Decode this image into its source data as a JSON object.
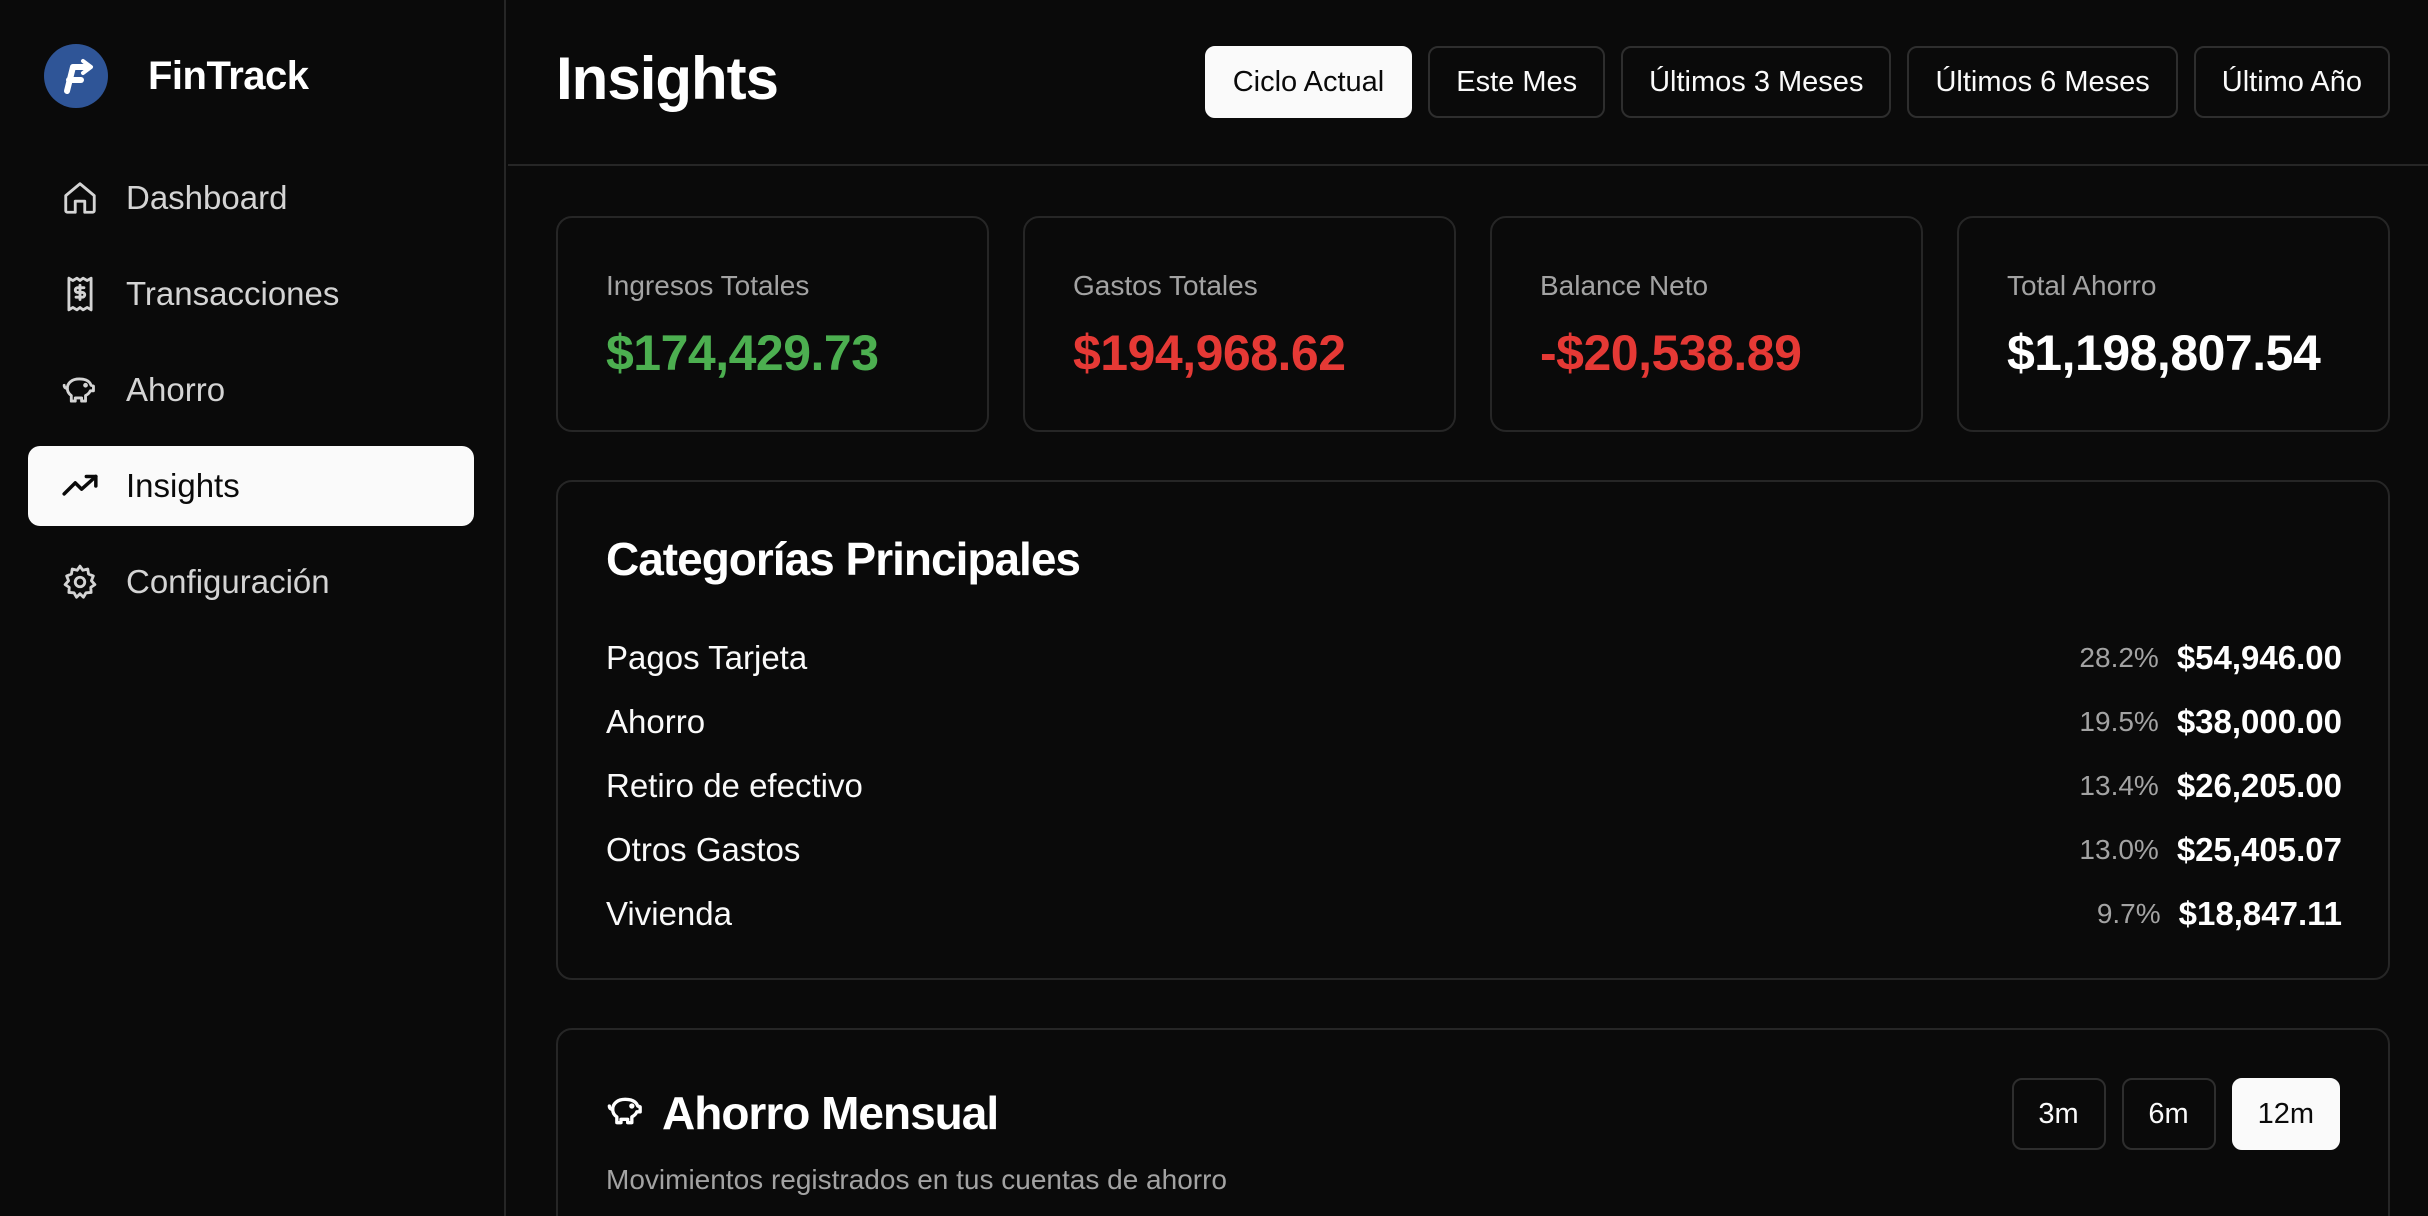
{
  "app": {
    "name": "FinTrack"
  },
  "sidebar": {
    "items": [
      {
        "label": "Dashboard",
        "icon": "home-icon",
        "active": false
      },
      {
        "label": "Transacciones",
        "icon": "receipt-icon",
        "active": false
      },
      {
        "label": "Ahorro",
        "icon": "piggy-bank-icon",
        "active": false
      },
      {
        "label": "Insights",
        "icon": "trending-up-icon",
        "active": true
      },
      {
        "label": "Configuración",
        "icon": "gear-icon",
        "active": false
      }
    ]
  },
  "header": {
    "title": "Insights",
    "ranges": [
      {
        "label": "Ciclo Actual",
        "active": true
      },
      {
        "label": "Este Mes",
        "active": false
      },
      {
        "label": "Últimos 3 Meses",
        "active": false
      },
      {
        "label": "Últimos 6 Meses",
        "active": false
      },
      {
        "label": "Último Año",
        "active": false
      }
    ]
  },
  "stats": [
    {
      "label": "Ingresos Totales",
      "value": "$174,429.73",
      "color": "#4caf50"
    },
    {
      "label": "Gastos Totales",
      "value": "$194,968.62",
      "color": "#e53935"
    },
    {
      "label": "Balance Neto",
      "value": "-$20,538.89",
      "color": "#e53935"
    },
    {
      "label": "Total Ahorro",
      "value": "$1,198,807.54",
      "color": "#ffffff"
    }
  ],
  "categories": {
    "title": "Categorías Principales",
    "rows": [
      {
        "name": "Pagos Tarjeta",
        "pct": "28.2%",
        "amount": "$54,946.00"
      },
      {
        "name": "Ahorro",
        "pct": "19.5%",
        "amount": "$38,000.00"
      },
      {
        "name": "Retiro de efectivo",
        "pct": "13.4%",
        "amount": "$26,205.00"
      },
      {
        "name": "Otros Gastos",
        "pct": "13.0%",
        "amount": "$25,405.07"
      },
      {
        "name": "Vivienda",
        "pct": "9.7%",
        "amount": "$18,847.11"
      }
    ]
  },
  "savings": {
    "title": "Ahorro Mensual",
    "subtitle": "Movimientos registrados en tus cuentas de ahorro",
    "periods": [
      {
        "label": "3m",
        "active": false
      },
      {
        "label": "6m",
        "active": false
      },
      {
        "label": "12m",
        "active": true
      }
    ]
  }
}
